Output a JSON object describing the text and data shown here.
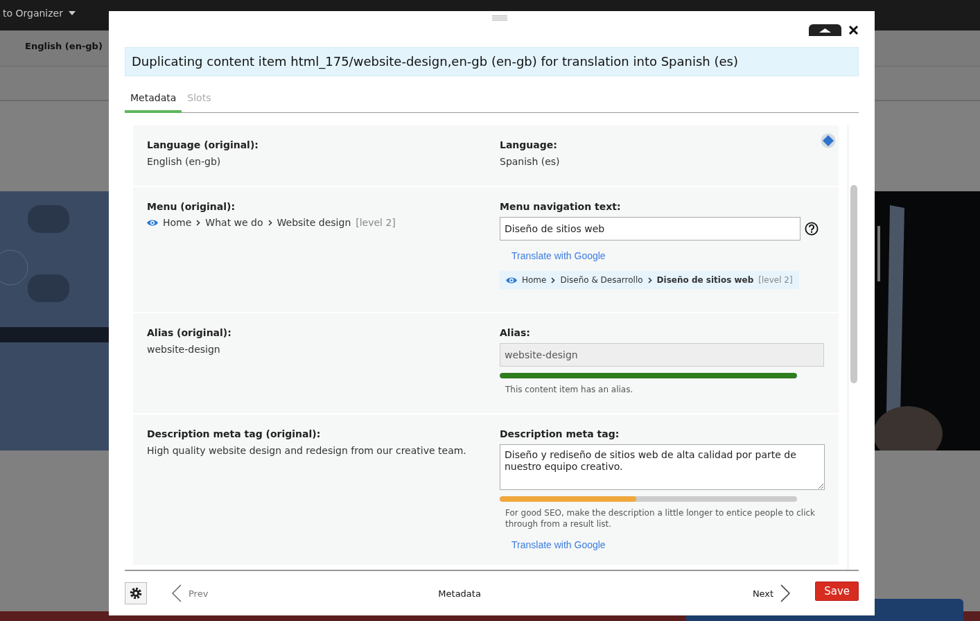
{
  "background": {
    "organizer_button": "to Organizer",
    "language_label": "English (en-gb)"
  },
  "modal": {
    "title": "Duplicating content item html_175/website-design,en-gb (en-gb) for translation into Spanish (es)",
    "tabs": [
      {
        "label": "Metadata",
        "selected": true
      },
      {
        "label": "Slots",
        "selected": false
      }
    ],
    "rows": [
      {
        "original": {
          "label": "Language (original):",
          "value": "English (en-gb)"
        },
        "translation": {
          "label": "Language:",
          "value": "Spanish (es)",
          "badge": true
        }
      },
      {
        "original": {
          "label": "Menu (original):",
          "breadcrumb": {
            "items": [
              {
                "text": "Home",
                "current": false
              },
              {
                "text": "What we do",
                "current": false
              },
              {
                "text": "Website design",
                "current": false
              }
            ],
            "level": "[level 2]"
          }
        },
        "translation": {
          "label": "Menu navigation text:",
          "field": {
            "kind": "input",
            "value": "Diseño de sitios web",
            "disabled": false
          },
          "help": true,
          "link": "Translate with Google",
          "breadcrumb": {
            "items": [
              {
                "text": "Home",
                "current": false
              },
              {
                "text": "Diseño & Desarrollo",
                "current": false
              },
              {
                "text": "Diseño de sitios web",
                "current": true
              }
            ],
            "level": "[level 2]"
          }
        }
      },
      {
        "original": {
          "label": "Alias (original):",
          "value": "website-design"
        },
        "translation": {
          "label": "Alias:",
          "field": {
            "kind": "input",
            "value": "website-design",
            "disabled": true
          },
          "meter": {
            "level": 1,
            "color": "#2e7d1e"
          },
          "note": "This content item has an alias."
        }
      },
      {
        "original": {
          "label": "Description meta tag (original):",
          "value": "High quality website design and redesign from our creative team."
        },
        "translation": {
          "label": "Description meta tag:",
          "field": {
            "kind": "textarea",
            "value": "Diseño y rediseño de sitios web de alta calidad por parte de nuestro equipo creativo.",
            "disabled": false
          },
          "meter": {
            "level": 0.46,
            "color": "#f0a73c"
          },
          "note": "For good SEO, make the description a little longer to entice people to click through from a result list.",
          "link": "Translate with Google"
        }
      }
    ],
    "footer": {
      "prev": "Prev",
      "section": "Metadata",
      "next": "Next",
      "save": "Save"
    }
  }
}
